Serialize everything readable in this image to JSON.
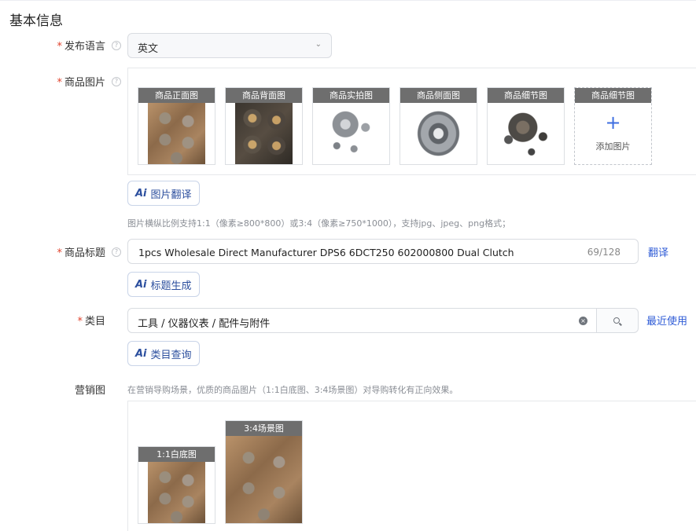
{
  "section": {
    "title": "基本信息"
  },
  "language": {
    "label": "发布语言",
    "value": "英文"
  },
  "product_images": {
    "label": "商品图片",
    "items": [
      {
        "caption": "商品正面图"
      },
      {
        "caption": "商品背面图"
      },
      {
        "caption": "商品实拍图"
      },
      {
        "caption": "商品侧面图"
      },
      {
        "caption": "商品细节图"
      }
    ],
    "add_slot": {
      "caption": "商品细节图",
      "plus": "+",
      "text": "添加图片"
    },
    "translate_button": "图片翻译",
    "hint": "图片横纵比例支持1:1（像素≥800*800）或3:4（像素≥750*1000），支持jpg、jpeg、png格式；"
  },
  "product_title": {
    "label": "商品标题",
    "value": "1pcs Wholesale Direct Manufacturer DPS6 6DCT250 602000800 Dual Clutch",
    "count": "69/128",
    "translate_link": "翻译",
    "generate_button": "标题生成"
  },
  "category": {
    "label": "类目",
    "value": "工具 / 仪器仪表 / 配件与附件",
    "recent_link": "最近使用",
    "query_button": "类目查询"
  },
  "marketing": {
    "label": "营销图",
    "hint": "在营销导购场景，优质的商品图片（1:1白底图、3:4场景图）对导购转化有正向效果。",
    "items": [
      {
        "caption": "1:1白底图"
      },
      {
        "caption": "3:4场景图"
      }
    ]
  },
  "common": {
    "required_mark": "*",
    "ai_mark": "Ai",
    "help_mark": "?",
    "chevron": "⌄",
    "clear_mark": "×"
  }
}
